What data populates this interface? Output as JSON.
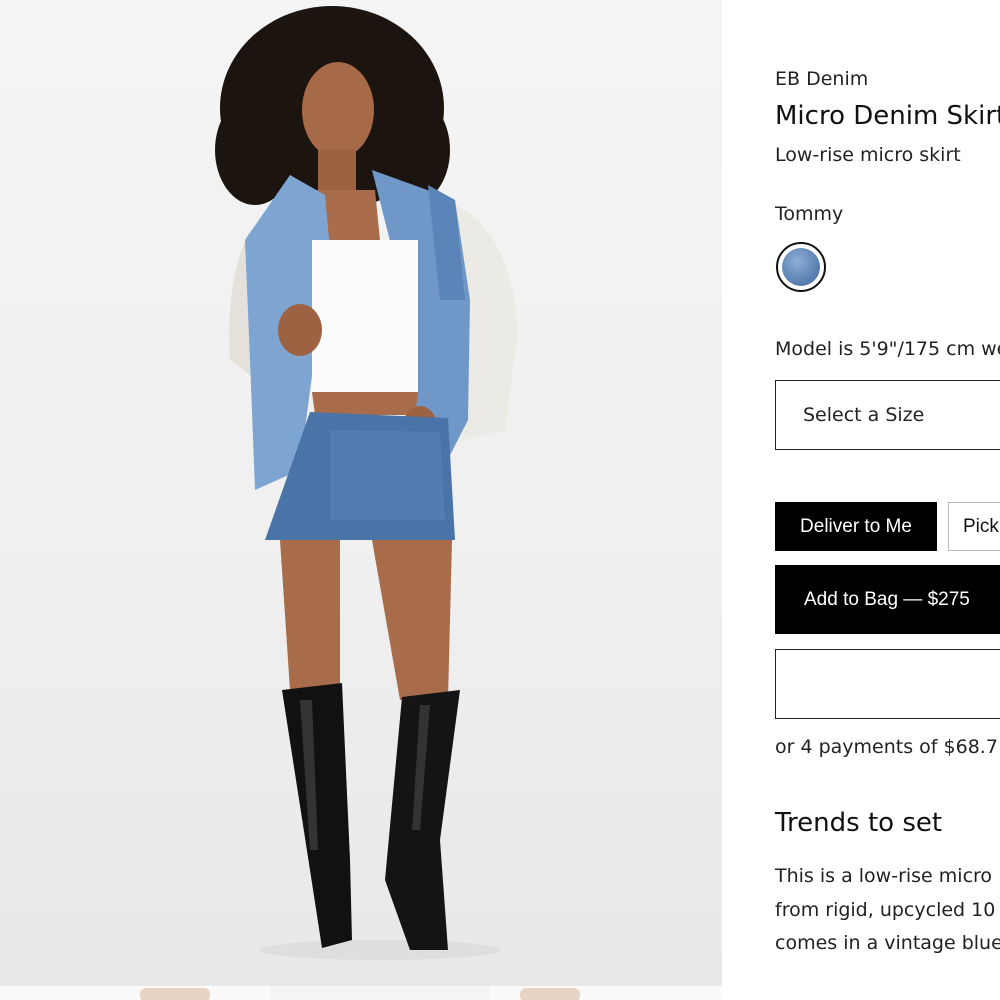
{
  "product": {
    "brand": "EB Denim",
    "title": "Micro Denim Skirt",
    "subtitle": "Low-rise micro skirt",
    "color_name": "Tommy",
    "swatch_color": "#5f86b7",
    "model_info": "Model is 5'9\"/175 cm we",
    "size_placeholder": "Select a Size"
  },
  "delivery": {
    "deliver_label": "Deliver to Me",
    "pickup_label": "Pick"
  },
  "cart": {
    "add_to_bag_label": "Add to Bag — $275",
    "payments_text": "or 4 payments of $68.7"
  },
  "description": {
    "heading": "Trends to set",
    "lines": [
      "This is a low-rise micro",
      "from rigid, upcycled 10",
      "comes in a vintage blue"
    ]
  }
}
